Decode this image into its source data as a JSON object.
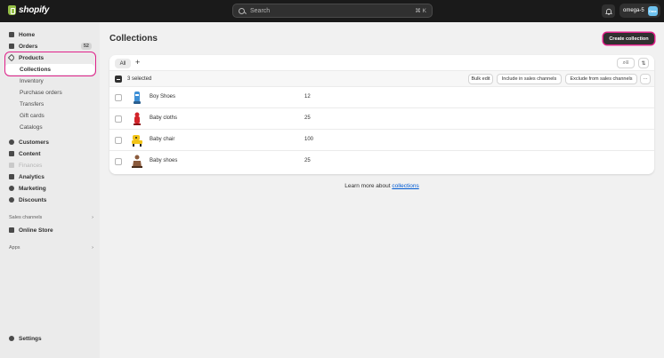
{
  "topbar": {
    "logo_text": "shopify",
    "search_placeholder": "Search",
    "search_shortcut": "⌘ K",
    "store_name": "omega-5",
    "store_avatar": "Ome"
  },
  "sidebar": {
    "home": "Home",
    "orders": "Orders",
    "orders_count": "52",
    "products": "Products",
    "collections": "Collections",
    "inventory": "Inventory",
    "purchase_orders": "Purchase orders",
    "transfers": "Transfers",
    "gift_cards": "Gift cards",
    "catalogs": "Catalogs",
    "customers": "Customers",
    "content": "Content",
    "finances": "Finances",
    "analytics": "Analytics",
    "marketing": "Marketing",
    "discounts": "Discounts",
    "sales_channels": "Sales channels",
    "online_store": "Online Store",
    "apps": "Apps",
    "settings": "Settings"
  },
  "main": {
    "title": "Collections",
    "create_button": "Create collection",
    "tab_all": "All",
    "tab_add": "+",
    "selected_text": "3 selected",
    "bulk_edit": "Bulk edit",
    "include_channels": "Include in sales channels",
    "exclude_channels": "Exclude from sales channels",
    "more": "···",
    "learn_prefix": "Learn more about ",
    "learn_link": "collections"
  },
  "collections": [
    {
      "title": "Boy Shoes",
      "count": "12",
      "thumb_color": "#3d8fd6"
    },
    {
      "title": "Baby cloths",
      "count": "25",
      "thumb_color": "#d2232a"
    },
    {
      "title": "Baby chair",
      "count": "100",
      "thumb_color": "#f2c418"
    },
    {
      "title": "Baby shoes",
      "count": "25",
      "thumb_color": "#8a5a3c"
    }
  ],
  "colors": {
    "highlight": "#e0218a",
    "topbar": "#1a1a1a",
    "primary_button": "#303030",
    "link": "#005bd3"
  }
}
